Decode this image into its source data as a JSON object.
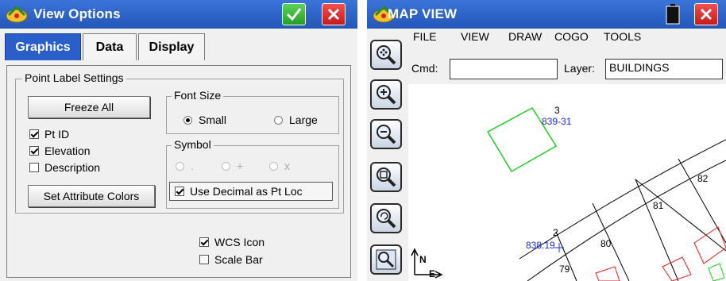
{
  "view_options": {
    "title": "View Options",
    "tabs": [
      "Graphics",
      "Data",
      "Display"
    ],
    "point_label_group": "Point Label Settings",
    "freeze_all": "Freeze All",
    "checkboxes": [
      {
        "label": "Pt ID",
        "checked": true
      },
      {
        "label": "Elevation",
        "checked": true
      },
      {
        "label": "Description",
        "checked": false
      }
    ],
    "set_attribute_colors": "Set Attribute Colors",
    "font_size_group": "Font Size",
    "font_small": "Small",
    "font_large": "Large",
    "font_selected": "Small",
    "symbol_group": "Symbol",
    "symbols": [
      ".",
      "+",
      "x"
    ],
    "use_decimal": "Use Decimal as Pt Loc",
    "use_decimal_checked": true,
    "wcs_icon": "WCS Icon",
    "wcs_icon_checked": true,
    "scale_bar": "Scale Bar",
    "scale_bar_checked": false
  },
  "map_view": {
    "title": "MAP VIEW",
    "menu": [
      "FILE",
      "VIEW",
      "DRAW",
      "COGO",
      "TOOLS"
    ],
    "cmd_label": "Cmd:",
    "cmd_value": "",
    "layer_label": "Layer:",
    "layer_value": "BUILDINGS",
    "points": [
      {
        "id": "3",
        "desc": "839-31"
      },
      {
        "id": "2",
        "desc": "838.19"
      }
    ],
    "lot_numbers": [
      "82",
      "81",
      "80",
      "79"
    ],
    "north_label": "N",
    "east_label": "E"
  },
  "colors": {
    "title_bar": "#2456b8",
    "point_label": "#1f2bd6",
    "building_green": "#22cc22",
    "building_red": "#e02020",
    "parcel_line": "#000000"
  }
}
